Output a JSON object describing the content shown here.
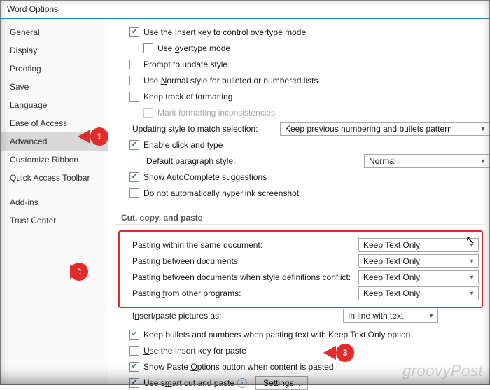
{
  "window": {
    "title": "Word Options"
  },
  "sidebar": {
    "items": [
      "General",
      "Display",
      "Proofing",
      "Save",
      "Language",
      "Ease of Access",
      "Advanced",
      "Customize Ribbon",
      "Quick Access Toolbar",
      "Add-ins",
      "Trust Center"
    ],
    "selected": "Advanced"
  },
  "editing": {
    "opt_insert_overtype": "Use the Insert key to control overtype mode",
    "opt_overtype": "Use overtype mode",
    "opt_prompt_update": "Prompt to update style",
    "opt_normal_lists": "Use Normal style for bulleted or numbered lists",
    "opt_track_format": "Keep track of formatting",
    "opt_mark_inconsist": "Mark formatting inconsistencies",
    "lbl_update_style": "Updating style to match selection:",
    "val_update_style": "Keep previous numbering and bullets pattern",
    "opt_click_type": "Enable click and type",
    "lbl_default_pstyle": "Default paragraph style:",
    "val_default_pstyle": "Normal",
    "opt_autocomplete": "Show AutoComplete suggestions",
    "opt_hyperlink_ss": "Do not automatically hyperlink screenshot"
  },
  "section_cut_copy_paste": "Cut, copy, and paste",
  "paste": {
    "lbl_within": "Pasting within the same document:",
    "lbl_between": "Pasting between documents:",
    "lbl_between_conflict": "Pasting between documents when style definitions conflict:",
    "lbl_other": "Pasting from other programs:",
    "val_within": "Keep Text Only",
    "val_between": "Keep Text Only",
    "val_between_conflict": "Keep Text Only",
    "val_other": "Keep Text Only",
    "lbl_pictures": "Insert/paste pictures as:",
    "val_pictures": "In line with text",
    "opt_keep_bullets": "Keep bullets and numbers when pasting text with Keep Text Only option",
    "opt_insert_paste": "Use the Insert key for paste",
    "opt_show_paste_btn": "Show Paste Options button when content is pasted",
    "opt_smart_cut": "Use smart cut and paste",
    "btn_settings": "Settings..."
  },
  "callouts": {
    "c1": "1",
    "c2": "2",
    "c3": "3"
  },
  "watermark": "groovyPost"
}
